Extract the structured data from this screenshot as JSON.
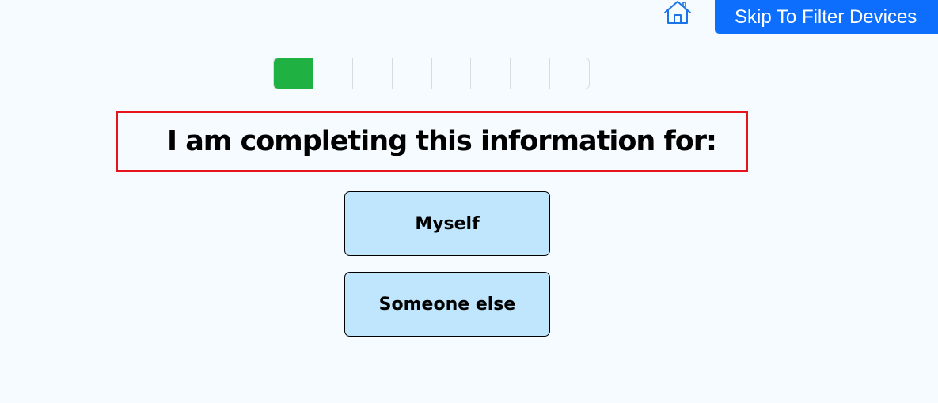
{
  "header": {
    "home_icon": "home-icon",
    "skip_label": "Skip To Filter Devices"
  },
  "progress": {
    "total_steps": 8,
    "completed_steps": 1,
    "fill_color": "#1fb141"
  },
  "question": {
    "title": "I am completing this information for:"
  },
  "options": [
    {
      "label": "Myself"
    },
    {
      "label": "Someone else"
    }
  ],
  "colors": {
    "background": "#f5fbfe",
    "primary_button": "#0d6efd",
    "option_button": "#bfe6fd",
    "highlight_border": "#e8141b"
  }
}
